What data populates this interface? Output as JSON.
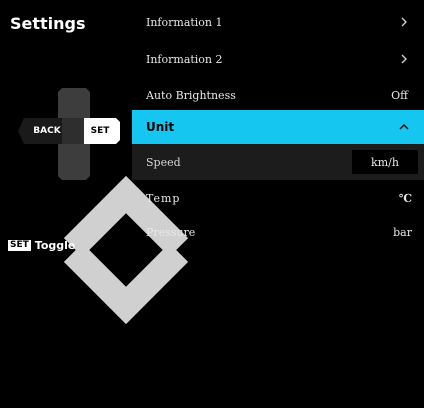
{
  "screen": {
    "title": "Settings",
    "accent_color": "#15c6f0"
  },
  "dpad": {
    "up_icon": "chevron-up-icon",
    "down_icon": "chevron-down-icon",
    "back_label": "BACK",
    "set_label": "SET"
  },
  "hint": {
    "key_label": "SET",
    "text": "Toggle"
  },
  "menu": {
    "items": [
      {
        "label": "Information 1",
        "icon": "chevron-right-icon"
      },
      {
        "label": "Information 2",
        "icon": "chevron-right-icon"
      },
      {
        "label": "Auto Brightness",
        "value": "Off"
      },
      {
        "label": "Unit",
        "icon": "chevron-up-icon",
        "expanded": true
      },
      {
        "label": "Speed",
        "value": "km/h",
        "selected": true
      },
      {
        "label": "Temp",
        "value": "℃"
      },
      {
        "label": "Pressure",
        "value": "bar"
      }
    ]
  }
}
